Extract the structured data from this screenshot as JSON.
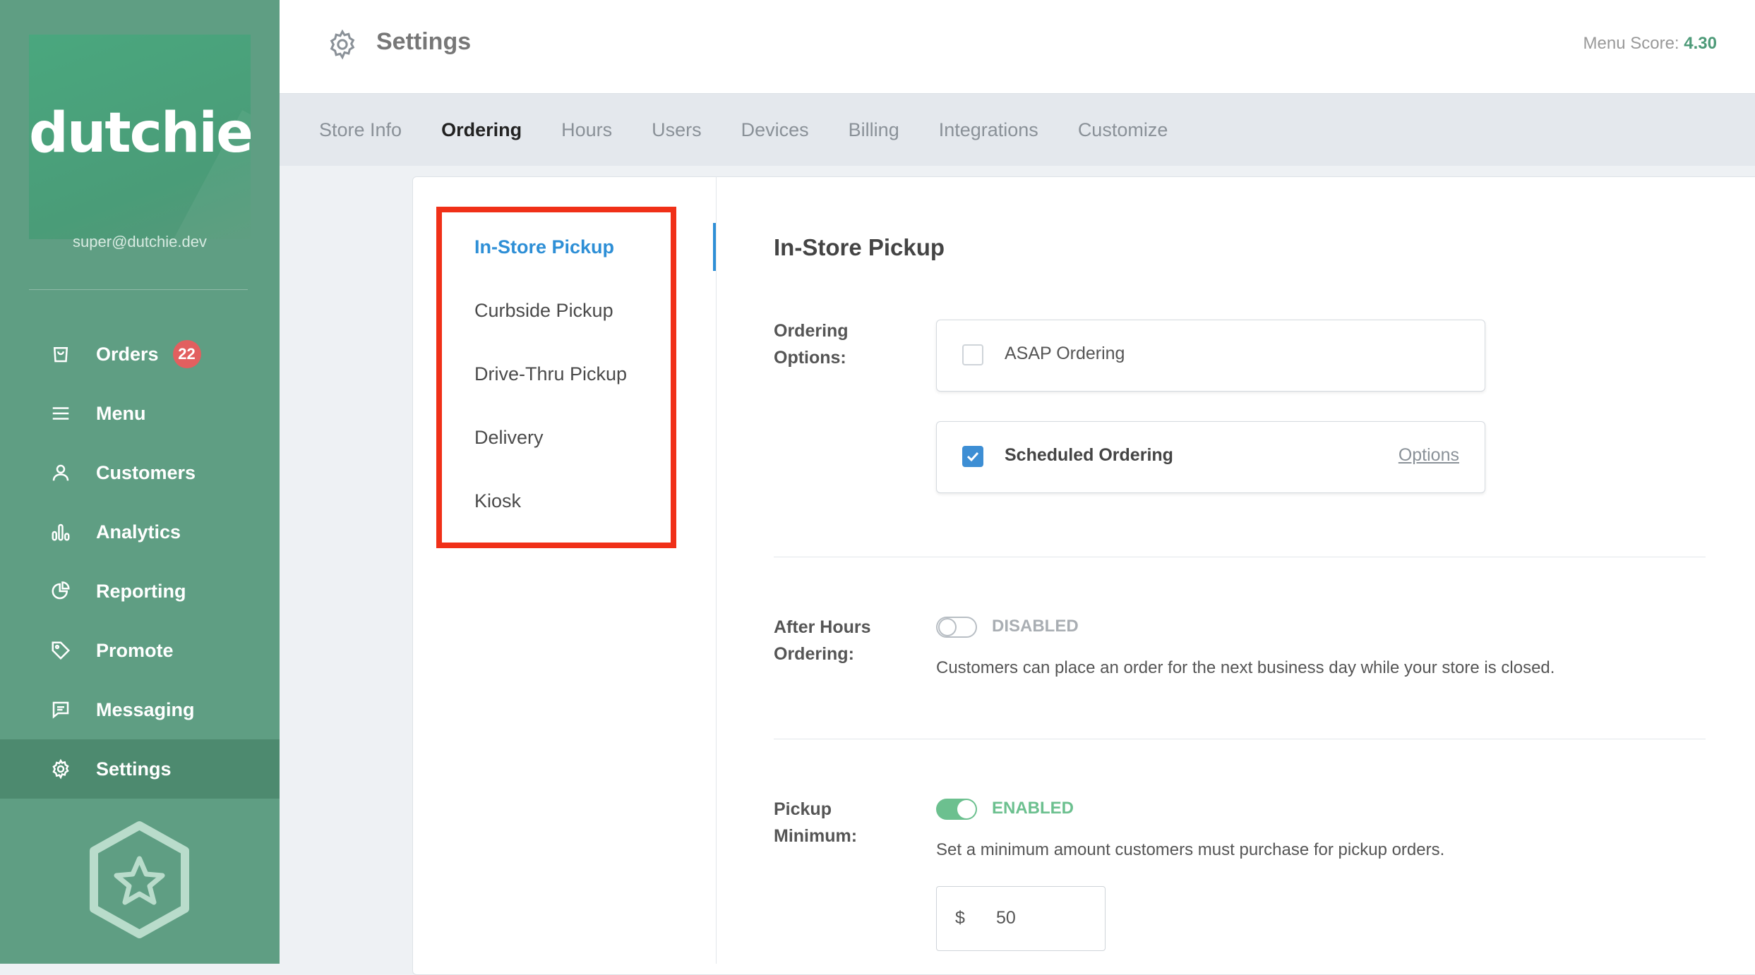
{
  "sidebar": {
    "logo": "dutchie",
    "email": "super@dutchie.dev",
    "items": [
      {
        "label": "Orders",
        "icon": "bag-icon",
        "badge": "22"
      },
      {
        "label": "Menu",
        "icon": "list-icon"
      },
      {
        "label": "Customers",
        "icon": "person-icon"
      },
      {
        "label": "Analytics",
        "icon": "bar-chart-icon"
      },
      {
        "label": "Reporting",
        "icon": "pie-chart-icon"
      },
      {
        "label": "Promote",
        "icon": "tag-icon"
      },
      {
        "label": "Messaging",
        "icon": "chat-icon"
      },
      {
        "label": "Settings",
        "icon": "gear-icon",
        "active": true
      }
    ]
  },
  "header": {
    "title": "Settings",
    "menu_score_label": "Menu Score:",
    "menu_score_value": "4.30"
  },
  "tabs": [
    "Store Info",
    "Ordering",
    "Hours",
    "Users",
    "Devices",
    "Billing",
    "Integrations",
    "Customize"
  ],
  "subnav": [
    "In-Store Pickup",
    "Curbside Pickup",
    "Drive-Thru Pickup",
    "Delivery",
    "Kiosk"
  ],
  "main": {
    "title": "In-Store Pickup",
    "ordering_options": {
      "label_line1": "Ordering",
      "label_line2": "Options:",
      "asap": {
        "label": "ASAP Ordering",
        "checked": false
      },
      "scheduled": {
        "label": "Scheduled Ordering",
        "checked": true,
        "link": "Options"
      }
    },
    "after_hours": {
      "label_line1": "After Hours",
      "label_line2": "Ordering:",
      "state": "DISABLED",
      "description": "Customers can place an order for the next business day while your store is closed."
    },
    "pickup_minimum": {
      "label_line1": "Pickup",
      "label_line2": "Minimum:",
      "state": "ENABLED",
      "description": "Set a minimum amount customers must purchase for pickup orders.",
      "currency": "$",
      "amount": "50"
    }
  },
  "colors": {
    "sidebar_bg": "#5f9e83",
    "accent_blue": "#2e8fd6",
    "enabled_green": "#6cc08f",
    "highlight_red": "#f03018"
  }
}
